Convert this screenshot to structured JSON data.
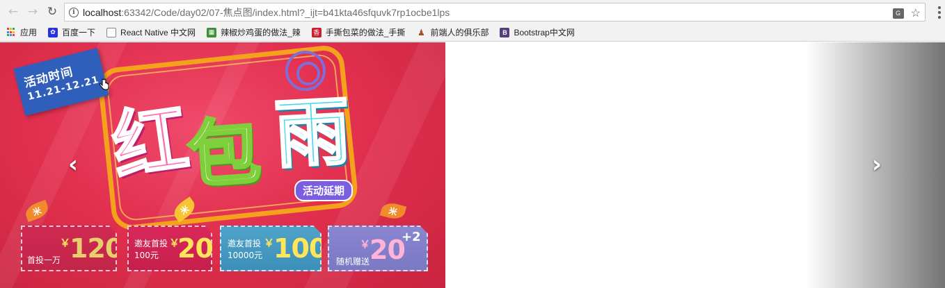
{
  "browser": {
    "url_host": "localhost",
    "url_path": ":63342/Code/day02/07-焦点图/index.html?_ijt=b41kta46sfquvk7rp1ocbe1lps",
    "back_icon": "back-arrow-icon",
    "forward_icon": "forward-arrow-icon",
    "reload_icon": "reload-icon"
  },
  "bookmarks": [
    {
      "label": "应用",
      "icon": "apps-grid-icon"
    },
    {
      "label": "百度一下",
      "icon": "baidu-paw-icon"
    },
    {
      "label": "React Native 中文网",
      "icon": "page-icon"
    },
    {
      "label": "辣椒炒鸡蛋的做法_辣",
      "icon": "recipe-icon"
    },
    {
      "label": "手撕包菜的做法_手撕",
      "icon": "xiang-icon"
    },
    {
      "label": "前端人的俱乐部",
      "icon": "person-icon"
    },
    {
      "label": "Bootstrap中文网",
      "icon": "bootstrap-icon"
    }
  ],
  "banner": {
    "time_title": "活动时间",
    "time_range": "11.21-12.21",
    "title_chars": [
      "红",
      "包",
      "雨"
    ],
    "extend_label": "活动延期",
    "leaf_char": "米",
    "coupons": [
      {
        "label": "首投一万",
        "yen": "￥",
        "amount": "120"
      },
      {
        "label_line1": "邀友首投",
        "label_line2": "100元",
        "yen": "￥",
        "amount": "20"
      },
      {
        "label_line1": "邀友首投",
        "label_line2": "10000元",
        "yen": "￥",
        "amount": "100"
      },
      {
        "label": "随机赠送",
        "yen": "￥",
        "amount": "20",
        "plus": "+2"
      }
    ]
  },
  "carousel": {
    "prev_glyph": "‹",
    "next_glyph": "›"
  },
  "colors": {
    "banner_red": "#e2304f",
    "badge_blue": "#2f5fba",
    "frame_orange": "#f4a21c",
    "amount_yellow": "#ffe55a",
    "amount_pink": "#ffb3d6"
  }
}
